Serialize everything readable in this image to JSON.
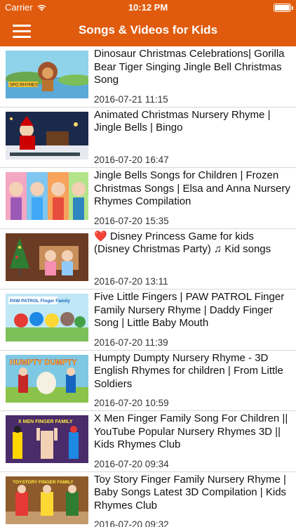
{
  "status": {
    "carrier": "Carrier",
    "time": "10:12 PM"
  },
  "nav": {
    "title": "Songs & Videos for Kids",
    "menu_icon": "hamburger-menu-icon"
  },
  "colors": {
    "bar": "#e05b0d",
    "text": "#111111",
    "divider": "#d9d9d9"
  },
  "videos": [
    {
      "title": "Dinosaur Christmas Celebrations| Gorilla Bear Tiger Singing Jingle Bell Christmas Song",
      "date": "2016-07-21 11:15",
      "thumb_text": "SPO RHYMES"
    },
    {
      "title": "Animated Christmas Nursery Rhyme | Jingle Bells | Bingo",
      "date": "2016-07-20 16:47",
      "thumb_text": ""
    },
    {
      "title": "Jingle Bells Songs for Children | Frozen Christmas Songs | Elsa and Anna Nursery Rhymes Compilation",
      "date": "2016-07-20 15:35",
      "thumb_text": ""
    },
    {
      "title": "Disney Princess Game for kids (Disney Christmas Party) ♫ Kid songs",
      "title_prefix": "❤️ ",
      "date": "2016-07-20 13:11",
      "thumb_text": ""
    },
    {
      "title": "Five Little Fingers | PAW PATROL Finger Family Nursery Rhyme | Daddy Finger Song | Little Baby Mouth",
      "date": "2016-07-20 11:39",
      "thumb_text": "PAW PATROL Finger Family"
    },
    {
      "title": "Humpty Dumpty Nursery Rhyme - 3D English Rhymes for children | From Little Soldiers",
      "date": "2016-07-20 10:59",
      "thumb_text": "HUMPTY DUMPTY"
    },
    {
      "title": "X Men Finger Family Song For Children || YouTube Popular Nursery Rhymes 3D || Kids Rhymes Club",
      "date": "2016-07-20 09:34",
      "thumb_text": "X MEN FINGER FAMILY"
    },
    {
      "title": "Toy Story Finger Family Nursery Rhyme | Baby Songs Latest 3D Compilation | Kids Rhymes Club",
      "date": "2016-07-20 09:32",
      "thumb_text": "TOYSTORY FINGER FAMILY"
    }
  ]
}
